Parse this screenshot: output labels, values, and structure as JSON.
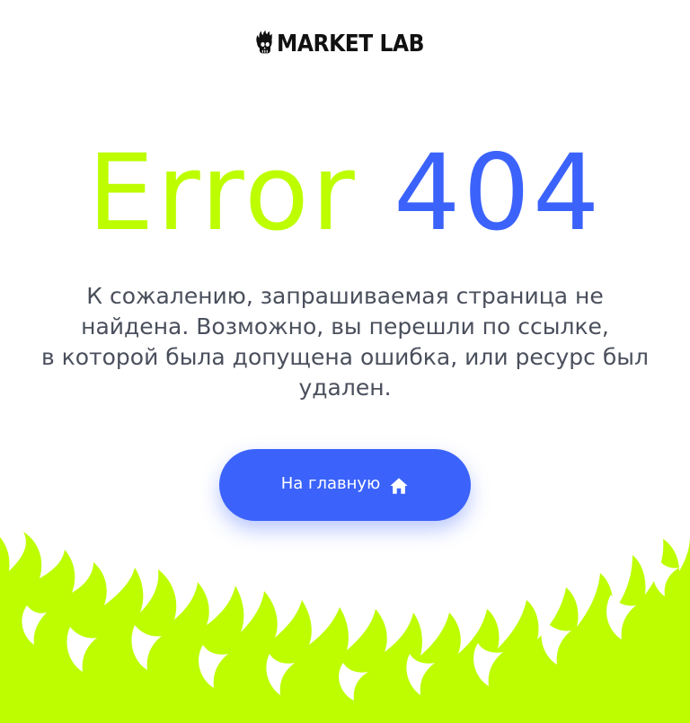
{
  "brand": {
    "name": "MARKET LAB",
    "logo_icon": "flaming-skull-icon"
  },
  "headline": {
    "word1": "Error",
    "word2": "404"
  },
  "message": {
    "line1": "К сожалению, запрашиваемая страница не",
    "line2": "найдена. Возможно, вы перешли по ссылке,",
    "line3": "в которой была допущена ошибка, или ресурс был",
    "line4": "удален."
  },
  "button": {
    "label": "На главную",
    "icon": "home-icon"
  },
  "colors": {
    "accent_lime": "#bdfd00",
    "accent_blue": "#3b63fb",
    "text": "#4a4f5c"
  }
}
